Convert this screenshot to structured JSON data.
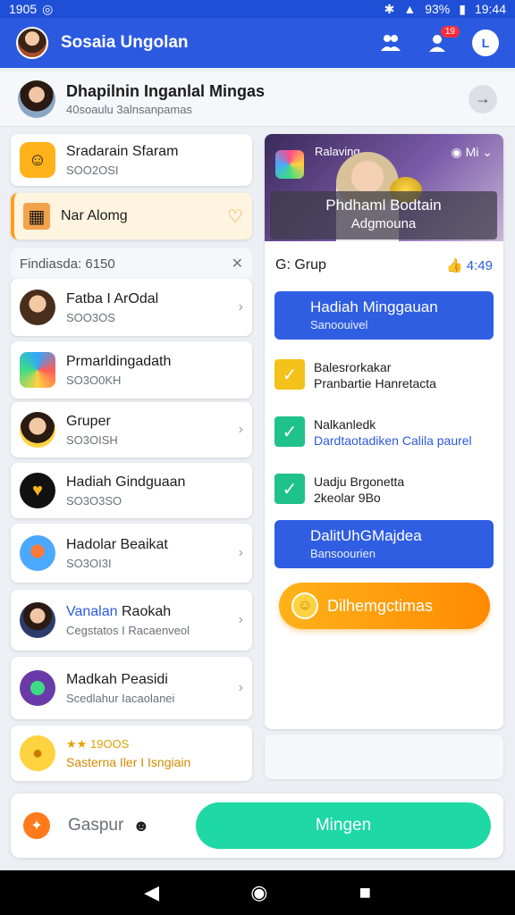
{
  "status_bar": {
    "time_left": "1905",
    "time_right": "19:44",
    "battery": "93%"
  },
  "app_bar": {
    "title": "Sosaia Ungolan",
    "notif_badge": "19",
    "profile_letter": "L"
  },
  "profile": {
    "name": "Dhapilnin Inganlal Mingas",
    "sub": "40soaulu 3alnsanpamas"
  },
  "left_list": {
    "items": [
      {
        "name": "Sradarain Sfaram",
        "sub": "SOO2OSI"
      },
      {
        "name": "Nar Alomg",
        "sub": ""
      },
      {
        "name": "Findiasda: 6150",
        "sub": ""
      },
      {
        "name": "Fatba I ArOdal",
        "sub": "SOO3OS"
      },
      {
        "name": "Prmarldingadath",
        "sub": "SO3O0KH"
      },
      {
        "name": "Gruper",
        "sub": "SO3OISH"
      },
      {
        "name": "Hadiah Gindguaan",
        "sub": "SO3O3SO"
      },
      {
        "name": "Hadolar Beaikat",
        "sub": "SO3OI3I"
      },
      {
        "name_blue": "Vanalan",
        "name": "Raokah",
        "sub": "Cegstatos I Racaenveol"
      },
      {
        "name": "Madkah Peasidi",
        "sub": "Scedlahur Iacaolanei"
      },
      {
        "name": "19OOS",
        "sub": "Sasterna Iler I Isngiain"
      }
    ]
  },
  "hero": {
    "tag": "Ralaving",
    "title": "Phdhaml Bodtain",
    "subtitle": "Adgmouna",
    "icons": "Mi"
  },
  "group": {
    "label": "G: Grup",
    "count": "4:49"
  },
  "buttons": {
    "weekly": {
      "title": "Hadiah Minggauan",
      "sub": "Sanoouivel"
    },
    "second": {
      "title": "DalitUhGMajdea",
      "sub": "Bansoourien"
    },
    "orange": "Dilhemgctimas"
  },
  "tasks": [
    {
      "line1": "Balesrorkakar",
      "line2": "Pranbartie Hanretacta",
      "line2_blue": false,
      "color": "#f4c21a"
    },
    {
      "line1": "Nalkanledk",
      "line2": "Dardtaotadiken Calila paurel",
      "line2_blue": true,
      "color": "#1fc28a"
    },
    {
      "line1": "Uadju Brgonetta",
      "line2": "2keolar 9Bo",
      "line2_blue": false,
      "color": "#1fc28a"
    }
  ],
  "bottom": {
    "label": "Gaspur",
    "mint_button": "Mingen"
  },
  "colors": {
    "primary": "#2b5ae0",
    "accent_orange": "#ff8a00",
    "accent_mint": "#1ed8a5"
  }
}
